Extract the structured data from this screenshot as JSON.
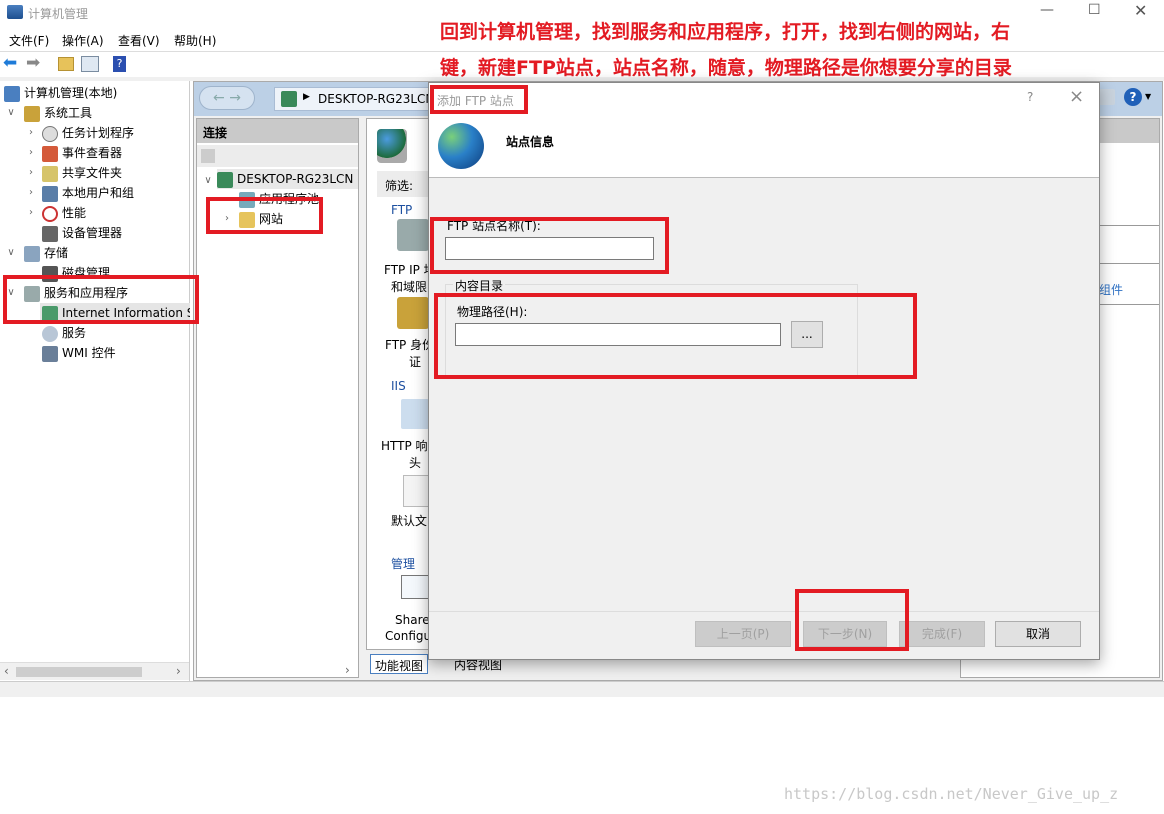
{
  "window": {
    "title": "计算机管理",
    "controls": [
      "minimize",
      "maximize",
      "close"
    ]
  },
  "annotation": {
    "line1": "回到计算机管理，找到服务和应用程序，打开，找到右侧的网站，右",
    "line2": "键，新建FTP站点，站点名称，随意，物理路径是你想要分享的目录",
    "color": "#e31b23"
  },
  "menu": [
    "文件(F)",
    "操作(A)",
    "查看(V)",
    "帮助(H)"
  ],
  "tree": {
    "root": "计算机管理(本地)",
    "items": [
      {
        "label": "系统工具",
        "level": 1,
        "expanded": true
      },
      {
        "label": "任务计划程序",
        "level": 2
      },
      {
        "label": "事件查看器",
        "level": 2
      },
      {
        "label": "共享文件夹",
        "level": 2
      },
      {
        "label": "本地用户和组",
        "level": 2
      },
      {
        "label": "性能",
        "level": 2
      },
      {
        "label": "设备管理器",
        "level": 2
      },
      {
        "label": "存储",
        "level": 1,
        "expanded": true
      },
      {
        "label": "磁盘管理",
        "level": 2
      },
      {
        "label": "服务和应用程序",
        "level": 1,
        "expanded": true
      },
      {
        "label": "Internet Information S",
        "level": 2,
        "selected": true
      },
      {
        "label": "服务",
        "level": 2
      },
      {
        "label": "WMI 控件",
        "level": 2
      }
    ]
  },
  "iis": {
    "address": "DESKTOP-RG23LCN",
    "connections_title": "连接",
    "server": "DESKTOP-RG23LCN",
    "app_pools": "应用程序池",
    "sites": "网站",
    "filter_label": "筛选:",
    "groups": {
      "ftp": "FTP",
      "iis": "IIS",
      "manage": "管理"
    },
    "features": [
      "FTP IP 地址和域限制",
      "FTP 身份验证",
      "HTTP 响应标头",
      "默认文档",
      "Shared Configuration"
    ],
    "features_visible": [
      "FTP IP 地",
      "和域限",
      "FTP 身份",
      "证",
      "HTTP 响",
      "头",
      "默认文",
      "Share",
      "Configu"
    ],
    "right_link": "组件",
    "tabs": {
      "features_view": "功能视图",
      "content_view": "内容视图"
    }
  },
  "dialog": {
    "title": "添加 FTP 站点",
    "help": "?",
    "close": "×",
    "heading": "站点信息",
    "site_name_label": "FTP 站点名称(T):",
    "site_name_value": "",
    "content_dir_group": "内容目录",
    "physical_path_label": "物理路径(H):",
    "physical_path_value": "",
    "browse": "...",
    "buttons": {
      "prev": "上一页(P)",
      "next": "下一步(N)",
      "finish": "完成(F)",
      "cancel": "取消"
    }
  },
  "watermark": "https://blog.csdn.net/Never_Give_up_z"
}
